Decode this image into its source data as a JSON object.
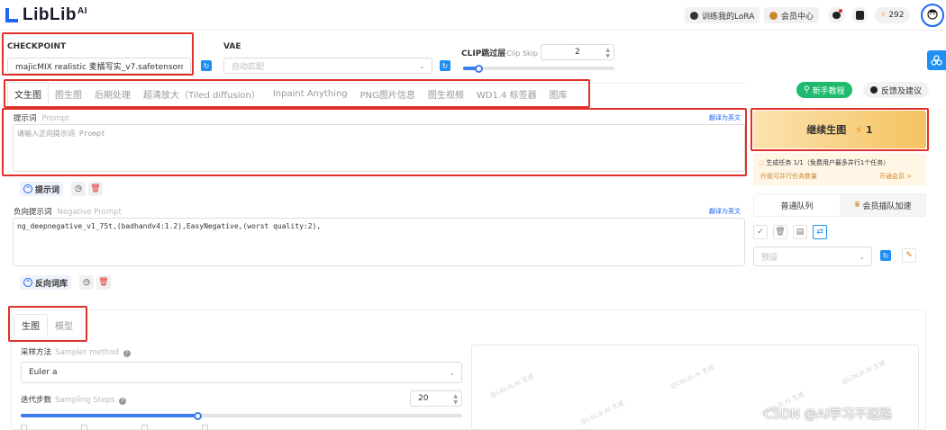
{
  "header": {
    "logo_text": "LibLib",
    "logo_sup": "AI",
    "train_lora": "训练我的LoRA",
    "member_center": "会员中心",
    "points": "292"
  },
  "checkpoint": {
    "label": "CHECKPOINT",
    "value": "majicMIX realistic 麦橘写实_v7.safetensors"
  },
  "vae": {
    "label": "VAE",
    "value": "自动匹配"
  },
  "clip_skip": {
    "label": "CLIP跳过层",
    "label_en": "Clip Skip",
    "value": "2",
    "fraction": 0.1
  },
  "tabs": [
    {
      "label": "文生图",
      "active": true
    },
    {
      "label": "图生图"
    },
    {
      "label": "后期处理"
    },
    {
      "label": "超清放大（Tiled diffusion）"
    },
    {
      "label": "Inpaint Anything"
    },
    {
      "label": "PNG图片信息"
    },
    {
      "label": "图生视频"
    },
    {
      "label": "WD1.4 标签器"
    },
    {
      "label": "图库"
    }
  ],
  "prompt": {
    "label": "提示词",
    "label_en": "Prompt",
    "translate": "翻译为英文",
    "placeholder": "请输入正向提示词 Prompt",
    "lib_button": "提示词"
  },
  "negative": {
    "label": "负向提示词",
    "label_en": "Negative Prompt",
    "translate": "翻译为英文",
    "value": "ng_deepnegative_v1_75t,(badhandv4:1.2),EasyNegative,(worst quality:2),",
    "lib_button": "反向词库"
  },
  "right_panel": {
    "tutorial": "新手教程",
    "feedback": "反馈及建议",
    "generate": "继续生图",
    "generate_cost": "1",
    "task_info": "生成任务 1/1（免费用户最多并行1个任务）",
    "upgrade_text": "升级可并行任务数量",
    "member_link": "开通会员 >",
    "queue_normal": "普通队列",
    "queue_vip": "会员插队加速",
    "preset_placeholder": "预设"
  },
  "sub_tabs": [
    {
      "label": "生图",
      "active": true
    },
    {
      "label": "模型"
    }
  ],
  "sampler": {
    "label": "采样方法",
    "label_en": "Sampler method",
    "value": "Euler a"
  },
  "steps": {
    "label": "迭代步数",
    "label_en": "Sampling Steps",
    "value": "20",
    "fraction": 0.4
  },
  "watermark_text": "@LibLib.AI 生成",
  "csdn_watermark": "CSDN @AI学习不迷路",
  "colors": {
    "brand_blue": "#1f66f2",
    "annotation_red": "#e0302a",
    "tutorial_green": "#1fba6e",
    "generate_gold": "#f5c260"
  }
}
